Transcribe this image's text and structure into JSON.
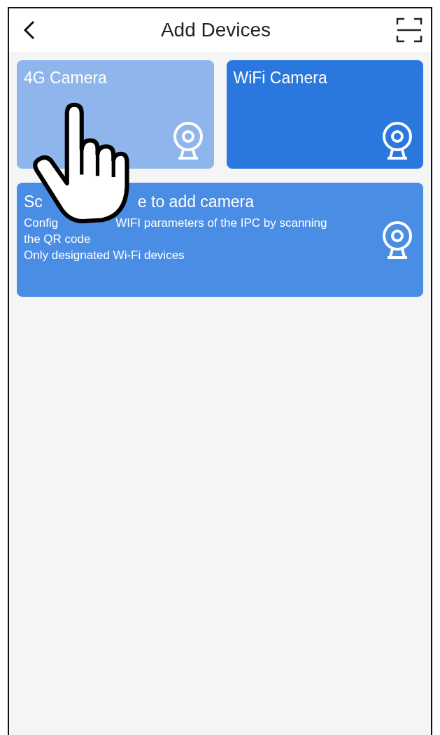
{
  "header": {
    "title": "Add Devices"
  },
  "device_cards": [
    {
      "label": "4G Camera",
      "selected": true
    },
    {
      "label": "WiFi Camera",
      "selected": false
    }
  ],
  "scan_card": {
    "title_parts": [
      "Sc",
      "e to add camera"
    ],
    "lines": [
      [
        "Config",
        "WIFI parameters of the IPC by scanning"
      ],
      [
        "the QR code"
      ],
      [
        "Only designated Wi-Fi devices"
      ]
    ]
  }
}
